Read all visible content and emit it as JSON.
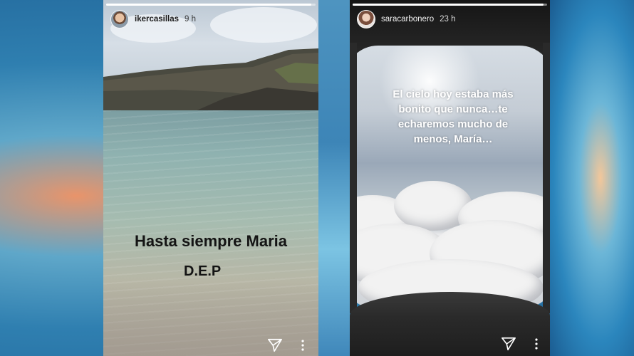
{
  "stories": [
    {
      "username": "ikercasillas",
      "time": "9 h",
      "progress": 0.98,
      "caption_line1": "Hasta siempre Maria",
      "caption_line2": "D.E.P",
      "icons": [
        "send-icon",
        "more-options-icon"
      ]
    },
    {
      "username": "saracarbonero",
      "time": "23 h",
      "progress": 0.98,
      "caption": "El cielo hoy estaba más bonito que nunca…te echaremos mucho de menos, María…",
      "icons": [
        "send-icon",
        "more-options-icon"
      ]
    }
  ]
}
